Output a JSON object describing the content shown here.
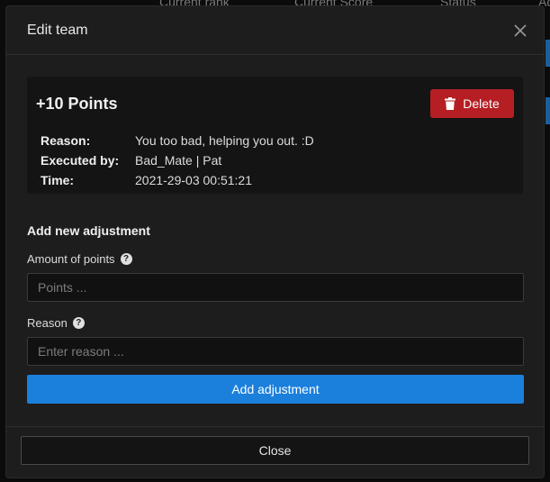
{
  "background": {
    "columns": [
      "Current rank",
      "Current Score",
      "Status",
      "Ac"
    ]
  },
  "modal": {
    "title": "Edit team",
    "close_icon": "close-icon"
  },
  "adjustment": {
    "title": "+10 Points",
    "delete_label": "Delete",
    "reason_key": "Reason:",
    "reason_value": "You too bad, helping you out. :D",
    "executed_key": "Executed by:",
    "executed_value": "Bad_Mate | Pat",
    "time_key": "Time:",
    "time_value": "2021-29-03 00:51:21"
  },
  "form": {
    "section_title": "Add new adjustment",
    "amount_label": "Amount of points",
    "amount_placeholder": "Points ...",
    "reason_label": "Reason",
    "reason_placeholder": "Enter reason ...",
    "submit_label": "Add adjustment"
  },
  "footer": {
    "close_label": "Close"
  },
  "colors": {
    "danger": "#b51e23",
    "primary": "#1b7fdc"
  }
}
